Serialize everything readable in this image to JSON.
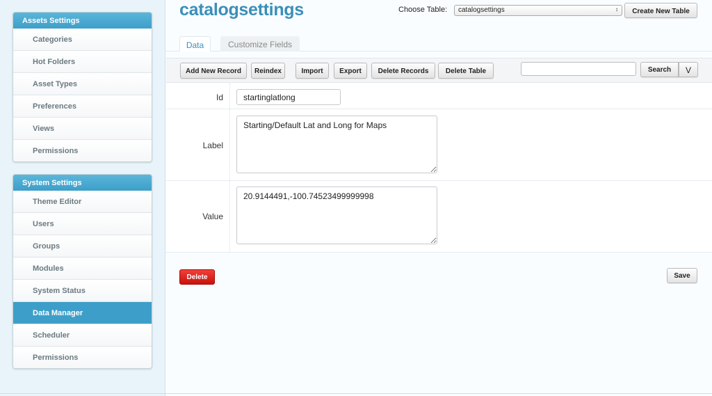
{
  "sidebar": {
    "assets_panel": {
      "title": "Assets Settings",
      "items": [
        "Categories",
        "Hot Folders",
        "Asset Types",
        "Preferences",
        "Views",
        "Permissions"
      ]
    },
    "system_panel": {
      "title": "System Settings",
      "items": [
        "Theme Editor",
        "Users",
        "Groups",
        "Modules",
        "System Status",
        "Data Manager",
        "Scheduler",
        "Permissions"
      ],
      "active_item": "Data Manager"
    }
  },
  "header": {
    "title": "catalogsettings",
    "choose_table_label": "Choose Table:",
    "selected_table": "catalogsettings",
    "select_arrows": "↕",
    "create_table_button": "Create New Table"
  },
  "tabs": [
    {
      "label": "Data",
      "active": true
    },
    {
      "label": "Customize Fields",
      "active": false
    }
  ],
  "toolbar": {
    "add_record": "Add New Record",
    "reindex": "Reindex",
    "import": "Import",
    "export": "Export",
    "delete_records": "Delete Records",
    "delete_table": "Delete Table",
    "search_value": "",
    "search_button": "Search",
    "toggle_button": "V"
  },
  "form": {
    "id": {
      "label": "Id",
      "value": "startinglatlong"
    },
    "label": {
      "label": "Label",
      "value": "Starting/Default Lat and Long for Maps"
    },
    "value": {
      "label": "Value",
      "value": "20.9144491,-100.74523499999998"
    }
  },
  "actions": {
    "delete": "Delete",
    "save": "Save"
  },
  "colors": {
    "accent": "#3a8fb9",
    "panel_header": "#4aa8d0",
    "active_item": "#3d9fc9",
    "danger": "#d9211a"
  }
}
